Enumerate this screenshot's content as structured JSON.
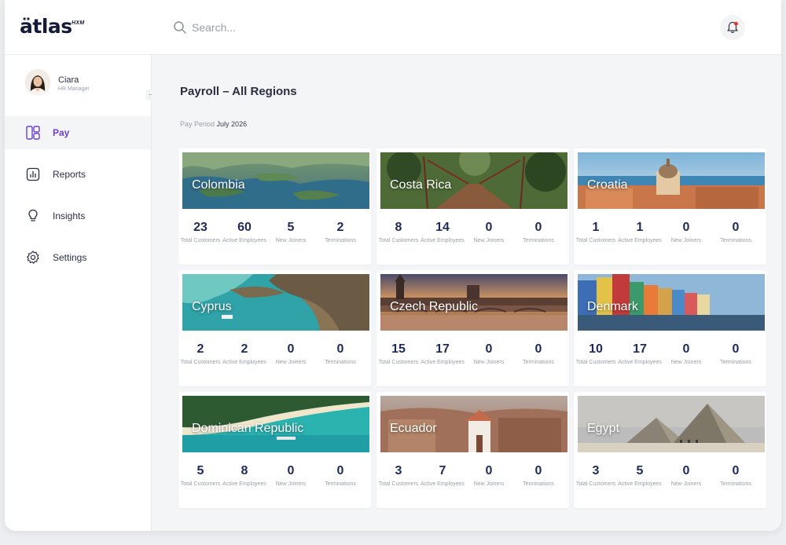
{
  "app": {
    "logo": "ätlas",
    "logo_sub": "HXM"
  },
  "search": {
    "placeholder": "Search..."
  },
  "user": {
    "name": "Ciara",
    "role": "HR Manager",
    "more": "..."
  },
  "nav": [
    {
      "label": "Pay",
      "icon": "layout-icon",
      "active": true
    },
    {
      "label": "Reports",
      "icon": "chart-icon",
      "active": false
    },
    {
      "label": "Insights",
      "icon": "lightbulb-icon",
      "active": false
    },
    {
      "label": "Settings",
      "icon": "gear-icon",
      "active": false
    }
  ],
  "page": {
    "title": "Payroll – All Regions",
    "period_label": "Pay Period",
    "period_value": "July 2026"
  },
  "stat_labels": {
    "total": "Total Customers",
    "active": "Active Employees",
    "joiners": "New Joiners",
    "terminations": "Terminations"
  },
  "regions": [
    {
      "name": "Colombia",
      "total": "23",
      "active": "60",
      "joiners": "5",
      "terminations": "2"
    },
    {
      "name": "Costa Rica",
      "total": "8",
      "active": "14",
      "joiners": "0",
      "terminations": "0"
    },
    {
      "name": "Croatia",
      "total": "1",
      "active": "1",
      "joiners": "0",
      "terminations": "0"
    },
    {
      "name": "Cyprus",
      "total": "2",
      "active": "2",
      "joiners": "0",
      "terminations": "0"
    },
    {
      "name": "Czech Republic",
      "total": "15",
      "active": "17",
      "joiners": "0",
      "terminations": "0"
    },
    {
      "name": "Denmark",
      "total": "10",
      "active": "17",
      "joiners": "0",
      "terminations": "0"
    },
    {
      "name": "Dominican Republic",
      "total": "5",
      "active": "8",
      "joiners": "0",
      "terminations": "0"
    },
    {
      "name": "Ecuador",
      "total": "3",
      "active": "7",
      "joiners": "0",
      "terminations": "0"
    },
    {
      "name": "Egypt",
      "total": "3",
      "active": "5",
      "joiners": "0",
      "terminations": "0"
    }
  ],
  "colors": {
    "accent": "#6b3fd6",
    "stat_value": "#1e2a5a",
    "notification_dot": "#e03131"
  }
}
